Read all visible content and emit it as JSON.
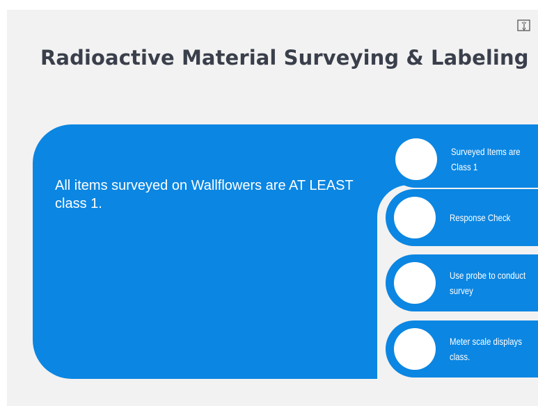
{
  "slide": {
    "title": "Radioactive Material Surveying & Labeling",
    "body_text": "All items surveyed on Wallflowers are AT LEAST class 1."
  },
  "toolbar": {
    "fullscreen_icon": "touch-fullscreen-icon"
  },
  "steps": [
    {
      "label": "Surveyed Items are Class 1",
      "active": true
    },
    {
      "label": "Response Check",
      "active": false
    },
    {
      "label": "Use probe to conduct survey",
      "active": false
    },
    {
      "label": "Meter scale displays class.",
      "active": false
    }
  ],
  "colors": {
    "accent": "#0b86e2",
    "background": "#f2f2f2",
    "title": "#3a3f4b"
  }
}
